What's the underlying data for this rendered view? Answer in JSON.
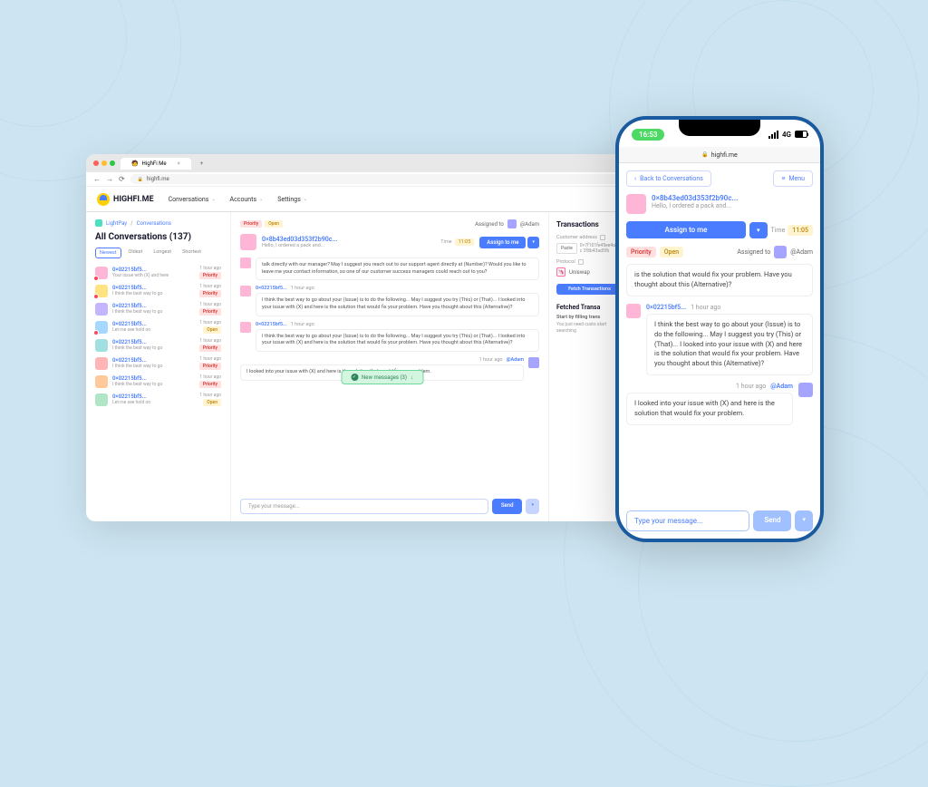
{
  "browser": {
    "tab_title": "HighFi Me",
    "url": "highfi.me"
  },
  "logo": "HIGHFI.ME",
  "nav": {
    "conversations": "Conversations",
    "accounts": "Accounts",
    "settings": "Settings"
  },
  "breadcrumb": {
    "workspace": "LightPay",
    "section": "Conversations"
  },
  "page_title": "All Conversations (137)",
  "filters": {
    "newest": "Newest",
    "oldest": "Oldest",
    "longest": "Longest",
    "shortest": "Shortest"
  },
  "tags": {
    "priority": "Priority",
    "open": "Open"
  },
  "conversations": [
    {
      "addr": "0×02215bf5...",
      "sub": "Your issue with (X) and here",
      "time": "1 hour ago",
      "tag": "Priority"
    },
    {
      "addr": "0×02215bf5...",
      "sub": "I think the best way to go",
      "time": "1 hour ago",
      "tag": "Priority"
    },
    {
      "addr": "0×02215bf5...",
      "sub": "I think the best way to go",
      "time": "1 hour ago",
      "tag": "Priority"
    },
    {
      "addr": "0×02215bf5...",
      "sub": "Let me see hold on",
      "time": "1 hour ago",
      "tag": "Open"
    },
    {
      "addr": "0×02215bf5...",
      "sub": "I think the best way to go",
      "time": "1 hour ago",
      "tag": "Priority"
    },
    {
      "addr": "0×02215bf5...",
      "sub": "I think the best way to go",
      "time": "1 hour ago",
      "tag": "Priority"
    },
    {
      "addr": "0×02215bf5...",
      "sub": "I think the best way to go",
      "time": "1 hour ago",
      "tag": "Priority"
    },
    {
      "addr": "0×02215bf5...",
      "sub": "Let me see hold on",
      "time": "1 hour ago",
      "tag": "Open"
    }
  ],
  "conv_header": {
    "assigned_label": "Assigned to",
    "assignee": "@Adam",
    "addr": "0×8b43ed03d353f2b90c...",
    "sub": "Hello, I ordered a pack and...",
    "time_label": "Time",
    "time_value": "11:05",
    "assign_btn": "Assign to me"
  },
  "messages": [
    {
      "name": "",
      "time": "",
      "text": "talk directly with our manager? May I suggest you reach out to our support agent directly at (Number)? Would you like to leave me your contact information, so one of our customer success managers could reach out to you?"
    },
    {
      "name": "0×02215bf5...",
      "time": "1 hour ago",
      "text": "I think the best way to go about your (Issue) is to do the following... May I suggest you try (This) or (That)... I looked into your issue with (X) and here is the solution that would fix your problem. Have you thought about this (Alternative)?"
    },
    {
      "name": "0×02215bf5...",
      "time": "1 hour ago",
      "text": "I think the best way to go about your (Issue) is to do the following... May I suggest you try (This) or (That)... I looked into your issue with (X) and here is the solution that would fix your problem. Have you thought about this (Alternative)?"
    }
  ],
  "right_msg": {
    "time": "1 hour ago",
    "name": "@Adam",
    "text": "I looked into your issue with (X) and here is the solution that would fix your problem."
  },
  "new_msg_label": "New messages (3)",
  "composer": {
    "placeholder": "Type your message...",
    "send": "Send"
  },
  "transactions": {
    "title": "Transactions",
    "customer_label": "Customer address",
    "paste": "Paste",
    "address": "0×7f101fe45ee4a4f2c 3f8b43ad5fb",
    "protocol_label": "Protocol",
    "protocol_name": "Uniswap",
    "fetch_btn": "Fetch Transactions",
    "fetched_title": "Fetched Transa",
    "start_label": "Start by filling trans",
    "start_text": "You just need custo start searching"
  },
  "phone": {
    "status_time": "16:53",
    "network": "4G",
    "url": "highfi.me",
    "back": "Back to Conversations",
    "menu": "Menu",
    "addr": "0×8b43ed03d353f2b90c...",
    "sub": "Hello, I ordered a pack and...",
    "assign": "Assign to me",
    "time_label": "Time",
    "time_value": "11:05",
    "assigned_label": "Assigned to",
    "assignee": "@Adam",
    "msg_top": "is the solution that would fix your problem. Have you thought about this (Alternative)?",
    "msg_main": {
      "name": "0×02215bf5...",
      "time": "1 hour ago",
      "text": "I think the best way to go about your (Issue) is to do the following... May I suggest you try (This) or (That)... I looked into your issue with (X) and here is the solution that would fix your problem. Have you thought about this (Alternative)?"
    },
    "msg_right": {
      "time": "1 hour ago",
      "name": "@Adam",
      "text": "I looked into your issue with (X) and here is the solution that would fix your problem."
    },
    "placeholder": "Type your message...",
    "send": "Send"
  }
}
